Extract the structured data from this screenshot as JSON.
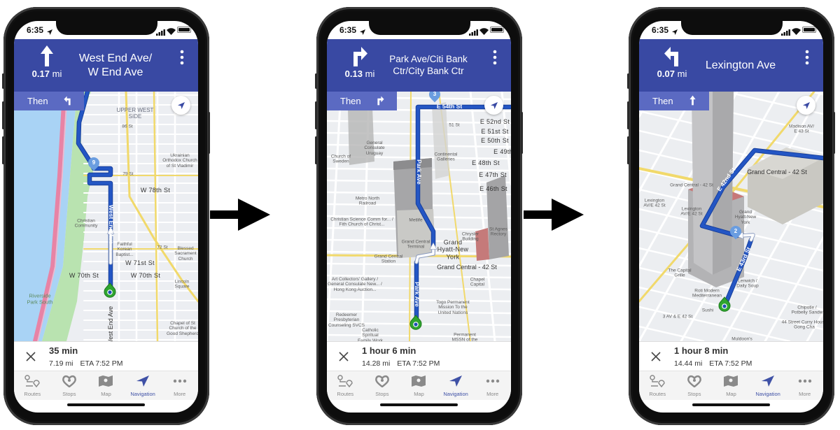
{
  "colors": {
    "header": "#3949a3",
    "then_bar": "#5b6ac2",
    "route": "#1f4fb5",
    "active_tab": "#3f51a6",
    "marker": "#2fa52f"
  },
  "tabs": [
    {
      "label": "Routes",
      "icon": "routes-icon"
    },
    {
      "label": "Stops",
      "icon": "stops-icon"
    },
    {
      "label": "Map",
      "icon": "map-icon"
    },
    {
      "label": "Navigation",
      "icon": "navigation-icon",
      "active": true
    },
    {
      "label": "More",
      "icon": "more-icon"
    }
  ],
  "phones": [
    {
      "status_time": "6:35",
      "header": {
        "turn_icon": "straight-arrow-icon",
        "distance_value": "0.17",
        "distance_unit": "mi",
        "street": "West End Ave/\nW End Ave"
      },
      "then": {
        "label": "Then",
        "icon": "turn-left-icon"
      },
      "map": {
        "waypoint": "9",
        "labels": [
          "UPPER WEST\nSIDE",
          "86 St",
          "Ukrainian\nOrthodox Church\nof St Vladimir",
          "79 St",
          "W 78th St",
          "Christian\nCommunity",
          "Faithful\nKorean\nBaptist...",
          "72 St",
          "Blessed\nSacrament\nChurch",
          "W 71st St",
          "W 70th St",
          "W 70th St",
          "Lincoln\nSquare",
          "Riverside\nPark South",
          "Chapel of St\nChurch of the\nGood Shepherd",
          "West End Ave",
          "West End Ave"
        ]
      },
      "summary": {
        "duration": "35 min",
        "distance": "7.19 mi",
        "eta": "ETA 7:52 PM"
      }
    },
    {
      "status_time": "6:35",
      "header": {
        "turn_icon": "turn-right-icon",
        "distance_value": "0.13",
        "distance_unit": "mi",
        "street": "Park Ave/Citi Bank\nCtr/City Bank Ctr"
      },
      "then": {
        "label": "Then",
        "icon": "turn-right-icon"
      },
      "map": {
        "waypoint": "3",
        "labels": [
          "E 54th St",
          "E 52nd St",
          "E 51st St",
          "E 50th St",
          "E 49th",
          "E 48th St",
          "E 47th St",
          "E 46th St",
          "51 St",
          "General\nConsulate\nUruguay",
          "Church of\nSweden",
          "Continental\nGalleries",
          "Park Ave",
          "Metro North\nRailroad",
          "Christian Science Comm for... /\nFith Church of Christ...",
          "Metlife",
          "Grand Central\nTerminal",
          "Chrysler\nBuilding",
          "St Agnes\nRectory",
          "Grand\nHyatt-New\nYork",
          "Grand Central\nStation",
          "Grand Central - 42 St",
          "Art Collectors' Gallery /\nGeneral Consulate New... /\nHong Kong Auction...",
          "Chapel\nCapital",
          "Park Ave",
          "Togo Permanent\nMission To the\nUnited Nations",
          "Redeemer\nPresbyterian\nCounseling SVCS",
          "Catholic\nSpiritual\nFamily Work",
          "Permanent\nMSSN of the"
        ]
      },
      "summary": {
        "duration": "1 hour 6 min",
        "distance": "14.28 mi",
        "eta": "ETA 7:52 PM"
      }
    },
    {
      "status_time": "6:35",
      "header": {
        "turn_icon": "turn-left-icon",
        "distance_value": "0.07",
        "distance_unit": "mi",
        "street": "Lexington Ave"
      },
      "then": {
        "label": "Then",
        "icon": "straight-arrow-icon"
      },
      "map": {
        "waypoint": "2",
        "labels": [
          "Madison AV/\nE 43 St",
          "Grand Central - 42 St",
          "Grand Central - 42 St",
          "Lexington\nAV/E 42 St",
          "E 42nd St",
          "Lexington\nAV/E 42 St",
          "Grand\nHyatt-New\nYork",
          "E 43rd St",
          "The Capital\nGrille",
          "Lenwich /\nDaily Soup",
          "Roti Modern\nMediterranean",
          "Sushi",
          "3 AV & E 42 St",
          "Chipotle /\nPotbelly Sandw",
          "44 Street Curry House\nGong Cha",
          "Muldoon's"
        ]
      },
      "summary": {
        "duration": "1 hour 8 min",
        "distance": "14.44 mi",
        "eta": "ETA 7:52 PM"
      }
    }
  ]
}
